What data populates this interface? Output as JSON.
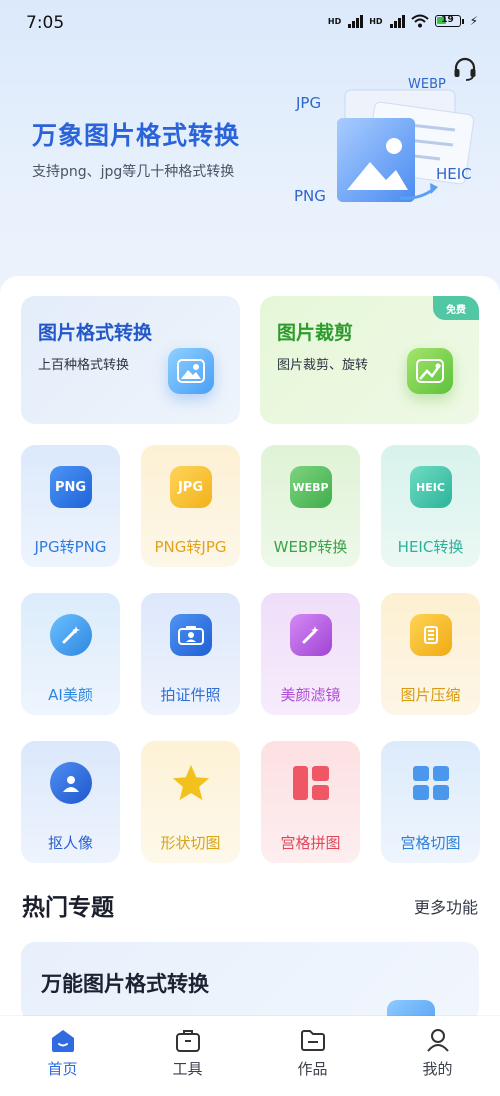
{
  "status_bar": {
    "time": "7:05",
    "battery": "19"
  },
  "hero": {
    "title": "万象图片格式转换",
    "subtitle": "支持png、jpg等几十种格式转换",
    "formats": [
      "JPG",
      "WEBP",
      "PNG",
      "HEIC"
    ]
  },
  "feature_cards": [
    {
      "title": "图片格式转换",
      "subtitle": "上百种格式转换"
    },
    {
      "title": "图片裁剪",
      "subtitle": "图片裁剪、旋转",
      "badge": "免费"
    }
  ],
  "tools": [
    {
      "label": "JPG转PNG",
      "icon_text": "PNG",
      "icon": "png-file-icon",
      "color": "#2f7be0"
    },
    {
      "label": "PNG转JPG",
      "icon_text": "JPG",
      "icon": "jpg-file-icon",
      "color": "#e2a21c"
    },
    {
      "label": "WEBP转换",
      "icon_text": "WEBP",
      "icon": "webp-file-icon",
      "color": "#3da14a"
    },
    {
      "label": "HEIC转换",
      "icon_text": "HEIC",
      "icon": "heic-file-icon",
      "color": "#2bb39a"
    },
    {
      "label": "AI美颜",
      "icon": "magic-wand-icon",
      "color": "#2f86e0"
    },
    {
      "label": "拍证件照",
      "icon": "id-camera-icon",
      "color": "#2f6fd9"
    },
    {
      "label": "美颜滤镜",
      "icon": "filter-wand-icon",
      "color": "#b04bd6"
    },
    {
      "label": "图片压缩",
      "icon": "compress-icon",
      "color": "#d99a12"
    },
    {
      "label": "抠人像",
      "icon": "portrait-cutout-icon",
      "color": "#2a5fd4"
    },
    {
      "label": "形状切图",
      "icon": "star-shape-icon",
      "color": "#d8a315"
    },
    {
      "label": "宫格拼图",
      "icon": "grid-collage-icon",
      "color": "#e0485a"
    },
    {
      "label": "宫格切图",
      "icon": "grid-cut-icon",
      "color": "#2f7fd6"
    }
  ],
  "section": {
    "title": "热门专题",
    "more": "更多功能"
  },
  "topic": {
    "title": "万能图片格式转换"
  },
  "nav": [
    {
      "label": "首页",
      "icon": "home-icon",
      "active": true
    },
    {
      "label": "工具",
      "icon": "toolbox-icon",
      "active": false
    },
    {
      "label": "作品",
      "icon": "folder-icon",
      "active": false
    },
    {
      "label": "我的",
      "icon": "user-icon",
      "active": false
    }
  ]
}
